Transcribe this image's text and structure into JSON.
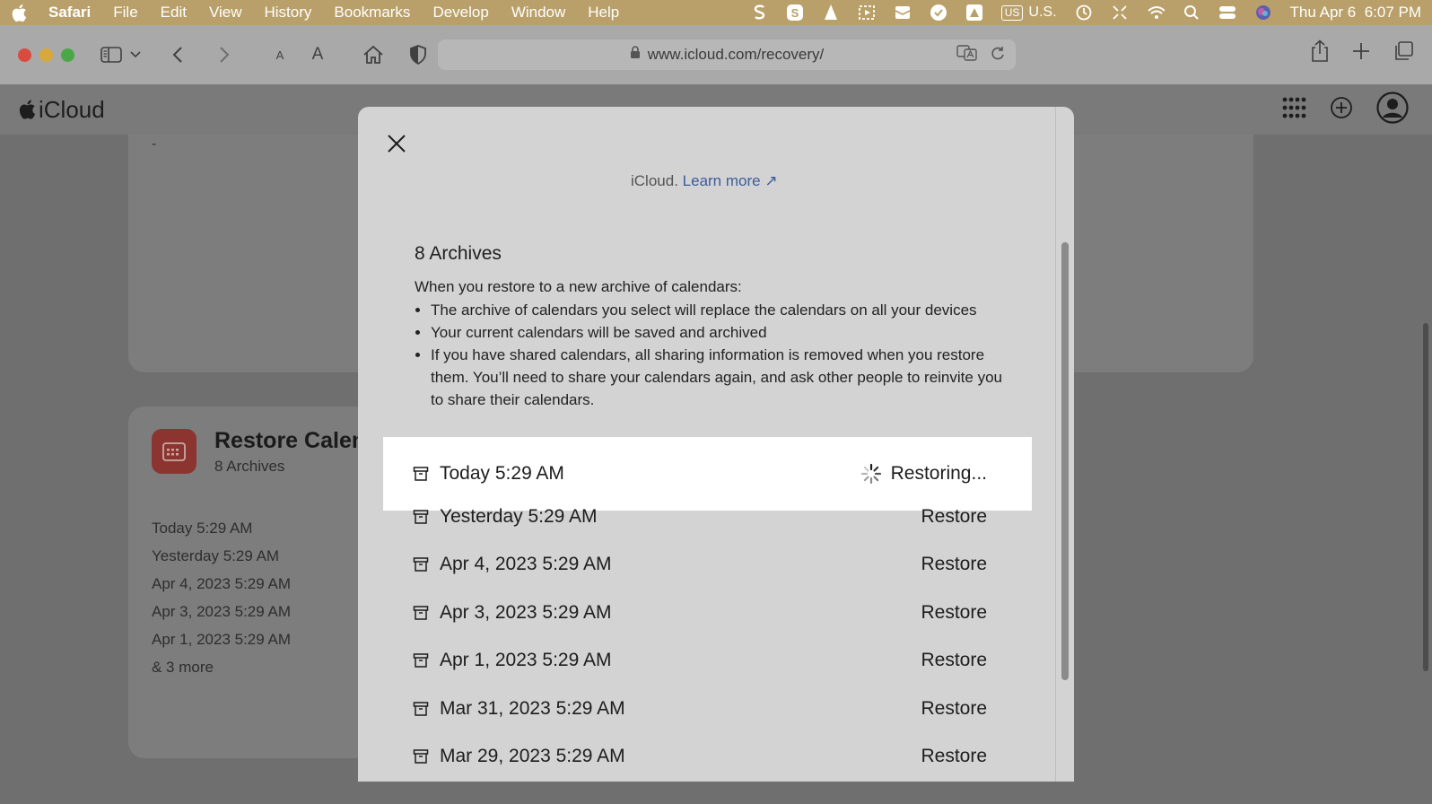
{
  "menubar": {
    "app": "Safari",
    "items": [
      "File",
      "Edit",
      "View",
      "History",
      "Bookmarks",
      "Develop",
      "Window",
      "Help"
    ],
    "input_source": "US",
    "input_label": "U.S.",
    "datetime": "Thu Apr 6  6:07 PM"
  },
  "browser": {
    "url": "www.icloud.com/recovery/",
    "text_small": "A",
    "text_large": "A"
  },
  "icloud": {
    "brand": "iCloud"
  },
  "background": {
    "dash": "-",
    "card_title": "Restore Calen",
    "card_subtitle": "8 Archives",
    "archives": [
      "Today 5:29 AM",
      "Yesterday 5:29 AM",
      "Apr 4, 2023 5:29 AM",
      "Apr 3, 2023 5:29 AM",
      "Apr 1, 2023 5:29 AM",
      "& 3 more"
    ]
  },
  "modal": {
    "learn_prefix": "iCloud.",
    "learn_link": "Learn more",
    "archive_count": "8 Archives",
    "intro": "When you restore to a new archive of calendars:",
    "bullets": [
      "The archive of calendars you select will replace the calendars on all your devices",
      "Your current calendars will be saved and archived",
      "If you have shared calendars, all sharing information is removed when you restore them. You’ll need to share your calendars again, and ask other people to reinvite you to share their calendars."
    ],
    "rows": [
      {
        "date": "Today 5:29 AM",
        "action": "Restoring..."
      },
      {
        "date": "Yesterday 5:29 AM",
        "action": "Restore"
      },
      {
        "date": "Apr 4, 2023 5:29 AM",
        "action": "Restore"
      },
      {
        "date": "Apr 3, 2023 5:29 AM",
        "action": "Restore"
      },
      {
        "date": "Apr 1, 2023 5:29 AM",
        "action": "Restore"
      },
      {
        "date": "Mar 31, 2023 5:29 AM",
        "action": "Restore"
      },
      {
        "date": "Mar 29, 2023 5:29 AM",
        "action": "Restore"
      }
    ]
  },
  "colors": {
    "menubar": "#b9a06a",
    "close_red": "#d94a3f",
    "minimize_yellow": "#d8a93a",
    "zoom_green": "#4aa847",
    "calendar_red": "#8c3530",
    "link_blue": "#3c5c9a"
  },
  "icons": [
    "apple-icon",
    "sidebar-icon",
    "back-icon",
    "forward-icon",
    "home-icon",
    "shield-icon",
    "lock-icon",
    "translate-icon",
    "reload-icon",
    "share-icon",
    "new-tab-icon",
    "tabs-icon",
    "apps-grid-icon",
    "add-icon",
    "account-icon",
    "close-icon",
    "archive-icon",
    "spinner-icon"
  ]
}
